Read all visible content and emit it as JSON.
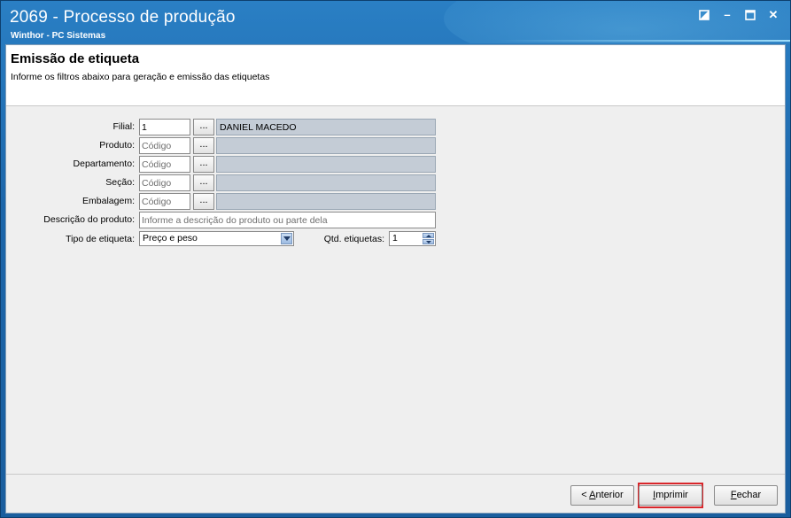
{
  "window": {
    "title": "2069 - Processo de produção",
    "subtitle": "Winthor - PC Sistemas",
    "controls": [
      {
        "name": "restore-icon"
      },
      {
        "name": "minimize-icon",
        "glyph": "–"
      },
      {
        "name": "maximize-icon"
      },
      {
        "name": "close-icon",
        "glyph": "✕"
      }
    ]
  },
  "header": {
    "title": "Emissão de etiqueta",
    "description": "Informe os filtros abaixo para geração e emissão das etiquetas"
  },
  "form": {
    "filial": {
      "label": "Filial:",
      "value": "1",
      "lookup": "...",
      "description": "DANIEL MACEDO"
    },
    "produto": {
      "label": "Produto:",
      "placeholder": "Código",
      "lookup": "...",
      "description": ""
    },
    "departamento": {
      "label": "Departamento:",
      "placeholder": "Código",
      "lookup": "...",
      "description": ""
    },
    "secao": {
      "label": "Seção:",
      "placeholder": "Código",
      "lookup": "...",
      "description": ""
    },
    "embalagem": {
      "label": "Embalagem:",
      "placeholder": "Código",
      "lookup": "...",
      "description": ""
    },
    "descricao_produto": {
      "label": "Descrição do produto:",
      "placeholder": "Informe a descrição do produto ou parte dela"
    },
    "tipo_etiqueta": {
      "label": "Tipo de etiqueta:",
      "selected": "Preço e peso"
    },
    "qtd_etiquetas": {
      "label": "Qtd. etiquetas:",
      "value": "1"
    }
  },
  "footer": {
    "anterior": {
      "prefix": "< ",
      "mnemonic": "A",
      "rest": "nterior"
    },
    "imprimir": {
      "mnemonic": "I",
      "rest": "mprimir"
    },
    "fechar": {
      "mnemonic": "F",
      "rest": "echar"
    }
  },
  "colors": {
    "title_bar": "#1d6fb0",
    "client_bg": "#efefef",
    "lookup_desc_bg": "#c4ccd6",
    "highlight": "#d9262b"
  }
}
